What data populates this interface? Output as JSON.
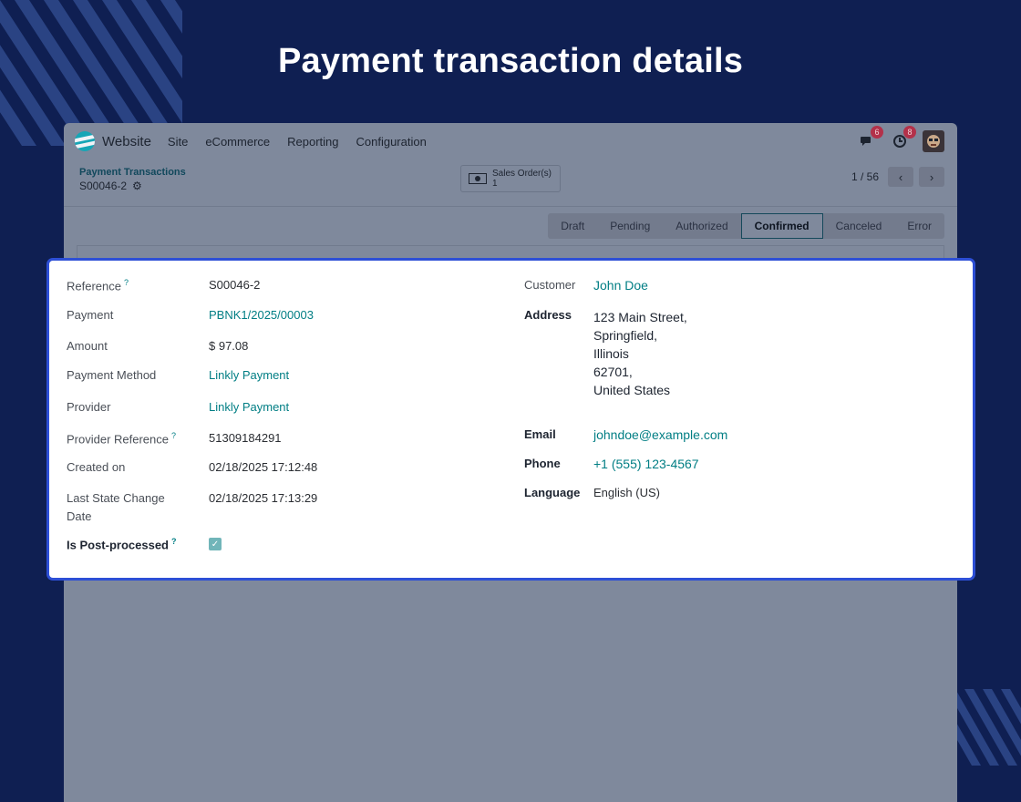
{
  "page_title": "Payment transaction details",
  "app": {
    "brand": "Website",
    "menu": [
      "Site",
      "eCommerce",
      "Reporting",
      "Configuration"
    ],
    "messages_badge": "6",
    "activities_badge": "8",
    "breadcrumb_parent": "Payment Transactions",
    "breadcrumb_current": "S00046-2",
    "smart_button_label": "Sales Order(s)",
    "smart_button_count": "1",
    "pager": "1 / 56",
    "stages": [
      "Draft",
      "Pending",
      "Authorized",
      "Confirmed",
      "Canceled",
      "Error"
    ],
    "active_stage": "Confirmed"
  },
  "form": {
    "left": {
      "reference_label": "Reference",
      "reference": "S00046-2",
      "payment_label": "Payment",
      "payment": "PBNK1/2025/00003",
      "amount_label": "Amount",
      "amount": "$ 97.08",
      "payment_method_label": "Payment Method",
      "payment_method": "Linkly Payment",
      "provider_label": "Provider",
      "provider": "Linkly Payment",
      "provider_reference_label": "Provider Reference",
      "provider_reference": "51309184291",
      "created_on_label": "Created on",
      "created_on": "02/18/2025 17:12:48",
      "last_state_change_label_1": "Last State Change",
      "last_state_change_label_2": "Date",
      "last_state_change": "02/18/2025 17:13:29",
      "post_processed_label": "Is Post-processed",
      "post_processed": true
    },
    "right": {
      "customer_label": "Customer",
      "customer": "John Doe",
      "address_label": "Address",
      "address_lines": [
        "123 Main Street,",
        "Springfield,",
        "Illinois",
        "62701,",
        "United States"
      ],
      "email_label": "Email",
      "email": "johndoe@example.com",
      "phone_label": "Phone",
      "phone": "+1 (555) 123-4567",
      "language_label": "Language",
      "language": "English (US)"
    }
  },
  "colors": {
    "background": "#0f1f52",
    "card_border": "#2d4fd6",
    "link": "#017e84"
  }
}
